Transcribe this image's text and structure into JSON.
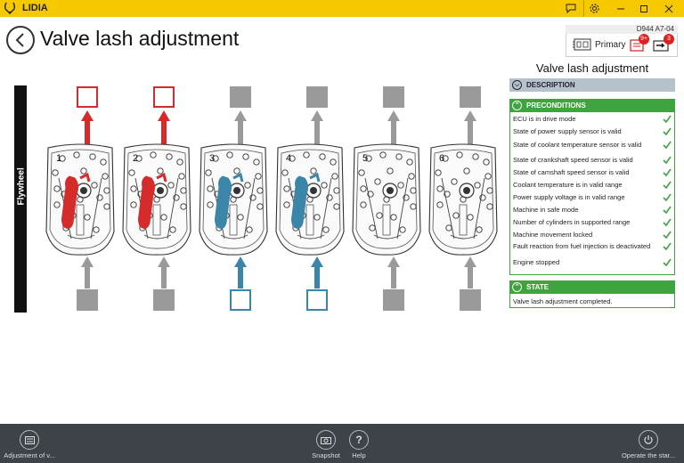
{
  "app": {
    "name": "LIDIA"
  },
  "header": {
    "title": "Valve lash adjustment",
    "status_code": "D944 A7-04",
    "ecu_label": "Primary",
    "badge_1": "9+",
    "badge_2": "3"
  },
  "diagram": {
    "flywheel_label": "Flywheel",
    "cylinders": [
      {
        "number": "1",
        "state": "red"
      },
      {
        "number": "2",
        "state": "red"
      },
      {
        "number": "3",
        "state": "blue"
      },
      {
        "number": "4",
        "state": "blue"
      },
      {
        "number": "5",
        "state": "grey"
      },
      {
        "number": "6",
        "state": "grey"
      }
    ],
    "colors": {
      "red": "#d62b2b",
      "blue": "#3b86a8",
      "grey": "#9a9a9a"
    }
  },
  "panel": {
    "title": "Valve lash adjustment",
    "description_header": "DESCRIPTION",
    "preconditions_header": "PRECONDITIONS",
    "preconditions": [
      "ECU is in drive mode",
      "State of power supply sensor is valid",
      "State of coolant temperature sensor is valid",
      "State of crankshaft speed sensor is valid",
      "State of camshaft speed sensor is valid",
      "Coolant temperature is in valid range",
      "Power supply voltage is in valid range",
      "Machine in safe mode",
      "Number of cylinders in supported range",
      "Machine movement locked",
      "Fault reaction from fuel injection is deactivated",
      "Engine stopped"
    ],
    "state_header": "STATE",
    "state_text": "Valve lash adjustment completed."
  },
  "bottombar": {
    "adjustment_label": "Adjustment of v...",
    "snapshot_label": "Snapshot",
    "help_label": "Help",
    "operate_label": "Operate the star..."
  }
}
